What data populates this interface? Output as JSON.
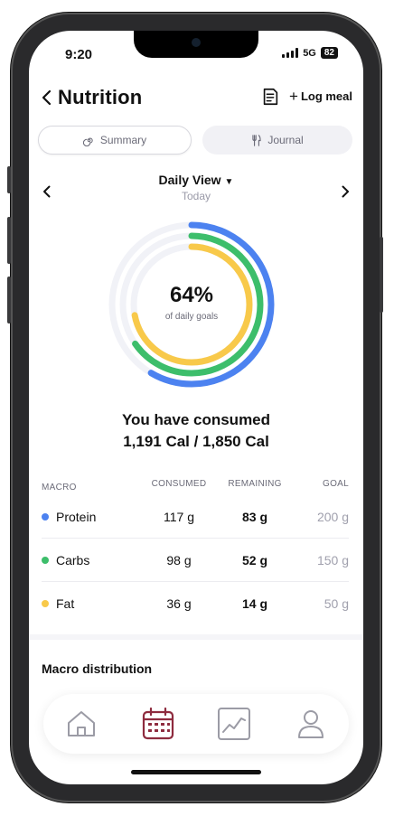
{
  "status": {
    "time": "9:20",
    "network": "5G",
    "battery": "82"
  },
  "header": {
    "title": "Nutrition",
    "log_meal": "Log meal"
  },
  "tabs": [
    {
      "label": "Summary",
      "icon": "spiral-icon",
      "active": true
    },
    {
      "label": "Journal",
      "icon": "fork-knife-icon",
      "active": false
    }
  ],
  "date_view": {
    "label": "Daily View",
    "sublabel": "Today"
  },
  "rings": {
    "percent_text": "64%",
    "label": "of daily goals",
    "series": [
      {
        "name": "Protein",
        "progress": 0.585,
        "color": "#4C82F0"
      },
      {
        "name": "Carbs",
        "progress": 0.653,
        "color": "#3DBE6B"
      },
      {
        "name": "Fat",
        "progress": 0.72,
        "color": "#F8C94A"
      }
    ]
  },
  "consumed": {
    "line1": "You have consumed",
    "line2": "1,191 Cal / 1,850 Cal"
  },
  "table": {
    "headers": {
      "macro": "MACRO",
      "consumed": "CONSUMED",
      "remaining": "REMAINING",
      "goal": "GOAL"
    },
    "rows": [
      {
        "name": "Protein",
        "color": "#4C82F0",
        "consumed": "117 g",
        "remaining": "83 g",
        "goal": "200 g"
      },
      {
        "name": "Carbs",
        "color": "#3DBE6B",
        "consumed": "98 g",
        "remaining": "52 g",
        "goal": "150 g"
      },
      {
        "name": "Fat",
        "color": "#F8C94A",
        "consumed": "36 g",
        "remaining": "14 g",
        "goal": "50 g"
      }
    ]
  },
  "section": {
    "title": "Macro distribution"
  },
  "nav": [
    {
      "icon": "home-icon",
      "active": false
    },
    {
      "icon": "calendar-icon",
      "active": true
    },
    {
      "icon": "chart-icon",
      "active": false
    },
    {
      "icon": "profile-icon",
      "active": false
    }
  ],
  "colors": {
    "accent": "#8E2B3E",
    "inactive": "#9b9ba5"
  }
}
